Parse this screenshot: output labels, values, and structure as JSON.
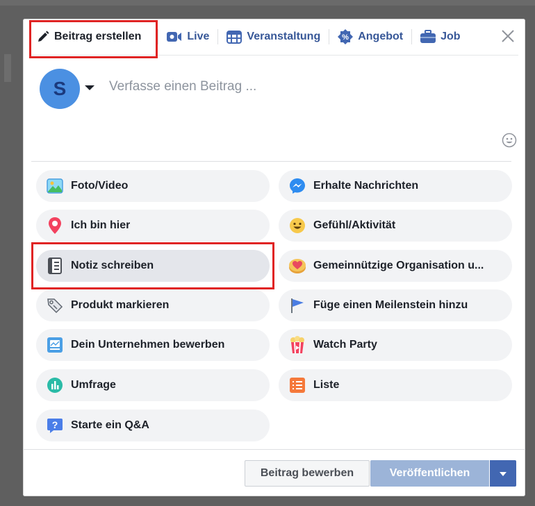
{
  "tabs": {
    "create_post": "Beitrag erstellen",
    "live": "Live",
    "event": "Veranstaltung",
    "offer": "Angebot",
    "job": "Job"
  },
  "composer": {
    "avatar_initial": "S",
    "placeholder": "Verfasse einen Beitrag ..."
  },
  "options": {
    "left": [
      {
        "label": "Foto/Video",
        "icon": "photo-video-icon"
      },
      {
        "label": "Ich bin hier",
        "icon": "location-pin-icon"
      },
      {
        "label": "Notiz schreiben",
        "icon": "notebook-icon"
      },
      {
        "label": "Produkt markieren",
        "icon": "tag-icon"
      },
      {
        "label": "Dein Unternehmen bewerben",
        "icon": "promote-business-icon"
      },
      {
        "label": "Umfrage",
        "icon": "poll-icon"
      },
      {
        "label": "Starte ein Q&A",
        "icon": "question-icon"
      }
    ],
    "right": [
      {
        "label": "Erhalte Nachrichten",
        "icon": "messenger-icon"
      },
      {
        "label": "Gefühl/Aktivität",
        "icon": "smiley-icon"
      },
      {
        "label": "Gemeinnützige Organisation u...",
        "icon": "charity-heart-icon"
      },
      {
        "label": "Füge einen Meilenstein hinzu",
        "icon": "milestone-flag-icon"
      },
      {
        "label": "Watch Party",
        "icon": "popcorn-icon"
      },
      {
        "label": "Liste",
        "icon": "list-icon"
      }
    ]
  },
  "footer": {
    "promote_label": "Beitrag bewerben",
    "publish_label": "Veröffentlichen"
  },
  "colors": {
    "brand_blue": "#4267b2",
    "link_blue": "#385898",
    "highlight_red": "#e02424",
    "publish_disabled": "#9cb4d8"
  }
}
